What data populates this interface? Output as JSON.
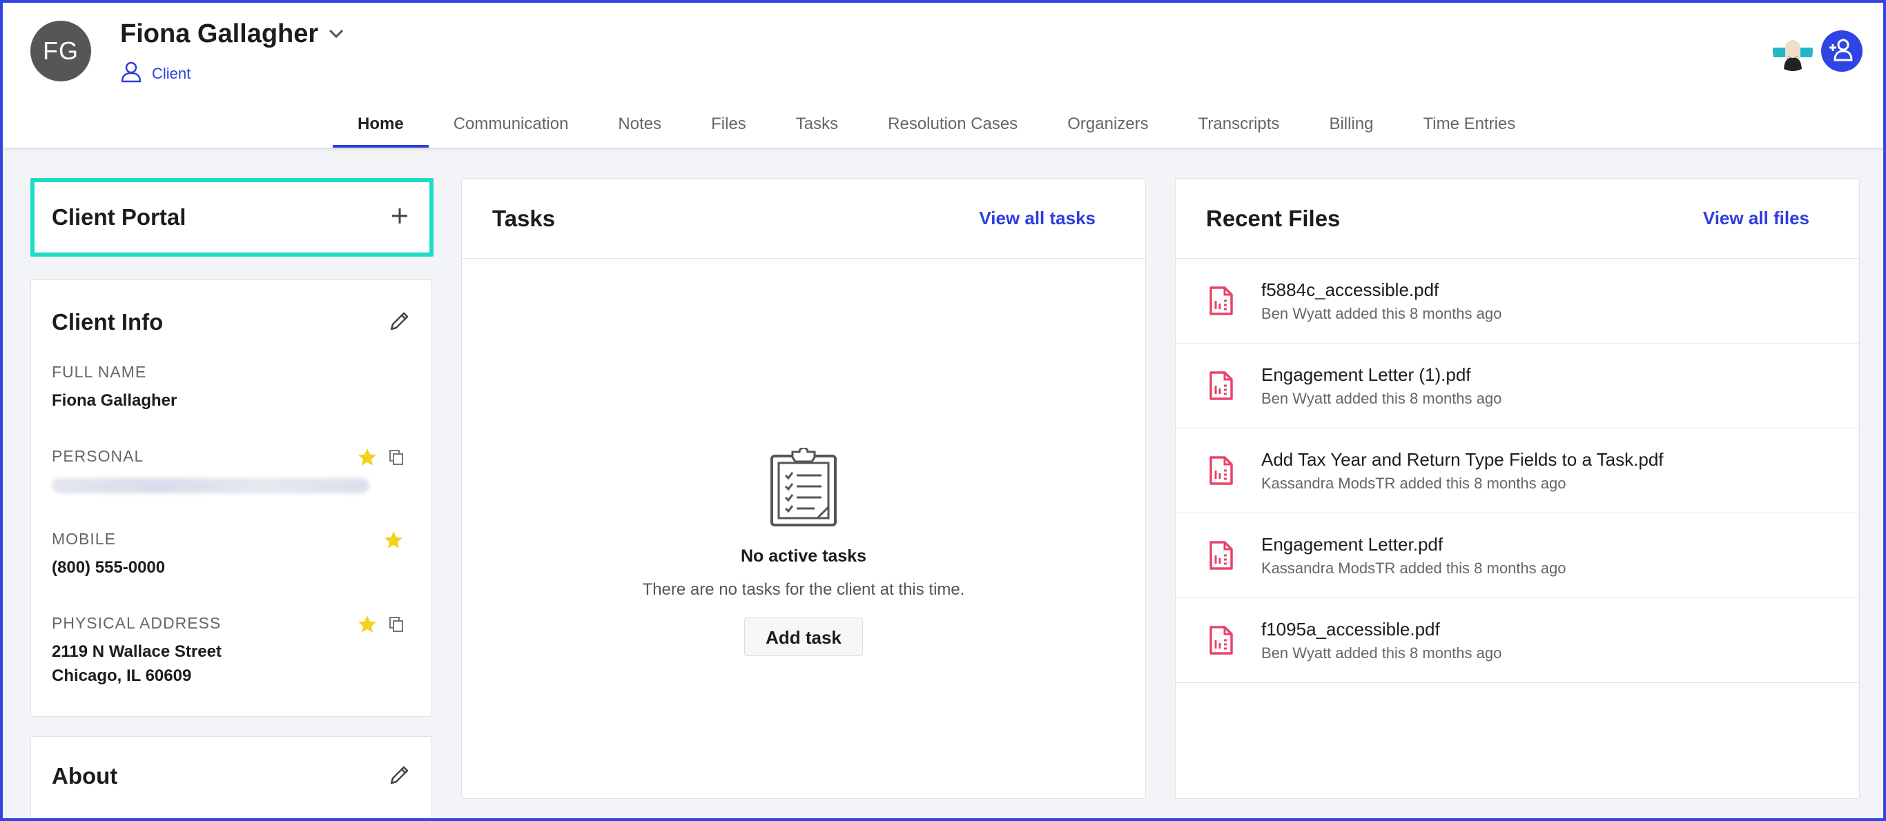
{
  "header": {
    "initials": "FG",
    "client_name": "Fiona Gallagher",
    "role_label": "Client"
  },
  "tabs": [
    {
      "label": "Home",
      "active": true
    },
    {
      "label": "Communication"
    },
    {
      "label": "Notes"
    },
    {
      "label": "Files"
    },
    {
      "label": "Tasks"
    },
    {
      "label": "Resolution Cases"
    },
    {
      "label": "Organizers"
    },
    {
      "label": "Transcripts"
    },
    {
      "label": "Billing"
    },
    {
      "label": "Time Entries"
    }
  ],
  "client_portal": {
    "title": "Client Portal"
  },
  "client_info": {
    "title": "Client Info",
    "full_name_label": "FULL NAME",
    "full_name": "Fiona Gallagher",
    "personal_label": "PERSONAL",
    "mobile_label": "MOBILE",
    "mobile": "(800) 555-0000",
    "address_label": "PHYSICAL ADDRESS",
    "address_line1": "2119 N Wallace Street",
    "address_line2": "Chicago, IL 60609"
  },
  "about": {
    "title": "About"
  },
  "tasks": {
    "title": "Tasks",
    "view_all": "View all tasks",
    "empty_title": "No active tasks",
    "empty_sub": "There are no tasks for the client at this time.",
    "add_task": "Add task"
  },
  "recent_files": {
    "title": "Recent Files",
    "view_all": "View all files",
    "files": [
      {
        "name": "f5884c_accessible.pdf",
        "meta": "Ben Wyatt added this 8 months ago"
      },
      {
        "name": "Engagement Letter (1).pdf",
        "meta": "Ben Wyatt added this 8 months ago"
      },
      {
        "name": "Add Tax Year and Return Type Fields to a Task.pdf",
        "meta": "Kassandra ModsTR added this 8 months ago"
      },
      {
        "name": "Engagement Letter.pdf",
        "meta": "Kassandra ModsTR added this 8 months ago"
      },
      {
        "name": "f1095a_accessible.pdf",
        "meta": "Ben Wyatt added this 8 months ago"
      }
    ]
  },
  "colors": {
    "accent": "#2f3dde",
    "highlight": "#1fdcc4",
    "star": "#f2d21b",
    "pdf": "#e8456b"
  },
  "icons": [
    "chevron-down-icon",
    "user-icon",
    "add-user-icon",
    "plus-icon",
    "pencil-icon",
    "star-icon",
    "copy-icon",
    "clipboard-icon",
    "pdf-file-icon"
  ]
}
